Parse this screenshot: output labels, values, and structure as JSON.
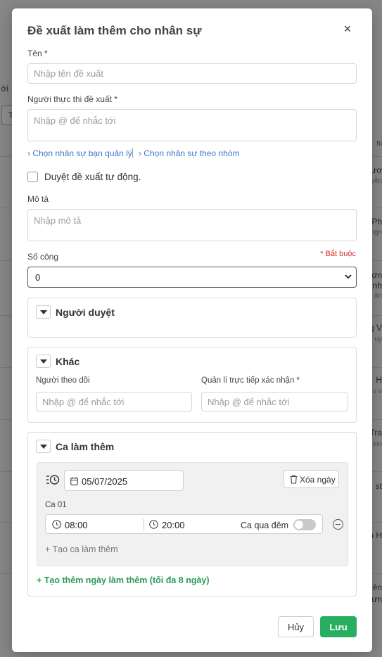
{
  "background": {
    "snippets": [
      "ời",
      "hi",
      "ươ",
      "uyên",
      "Ph",
      "ngn",
      "ươn",
      "nh",
      "ản",
      "g V",
      "uy",
      "H",
      "u v",
      "Tra",
      "ion",
      "st",
      "n H",
      "ên",
      "ưn"
    ],
    "button_label": "T"
  },
  "modal": {
    "title": "Đề xuất làm thêm cho nhân sự",
    "close_icon": "×"
  },
  "form": {
    "name": {
      "label": "Tên *",
      "placeholder": "Nhập tên đề xuất",
      "value": ""
    },
    "executor": {
      "label": "Người thực thi đề xuất *",
      "placeholder": "Nhập @ để nhắc tới",
      "value": ""
    },
    "links": {
      "managed": "› Chọn nhân sự bạn quản lý",
      "group": "› Chọn nhân sự theo nhóm"
    },
    "auto_approve": {
      "label": "Duyệt đề xuất tự động.",
      "checked": false
    },
    "description": {
      "label": "Mô tả",
      "placeholder": "Nhập mô tả",
      "value": ""
    },
    "work_units": {
      "label": "Số công",
      "required_note": "* Bắt buộc",
      "value": "0"
    }
  },
  "sections": {
    "approvers": {
      "title": "Người duyệt"
    },
    "other": {
      "title": "Khác",
      "follower_label": "Người theo dõi",
      "follower_placeholder": "Nhập @ để nhắc tới",
      "manager_label": "Quản lí trực tiếp xác nhận *",
      "manager_placeholder": "Nhập @ để nhắc tới"
    },
    "overtime": {
      "title": "Ca làm thêm",
      "date": "05/07/2025",
      "delete_day": "Xóa ngày",
      "shift_label": "Ca 01",
      "start_time": "08:00",
      "end_time": "20:00",
      "overnight_label": "Ca qua đêm",
      "overnight": false,
      "add_shift": "+ Tạo ca làm thêm",
      "add_day": "+ Tạo thêm ngày làm thêm (tối đa 8 ngày)"
    }
  },
  "footer": {
    "cancel": "Hủy",
    "save": "Lưu"
  },
  "colors": {
    "primary": "#27ae60",
    "link": "#3a78c2",
    "required": "#d23030"
  }
}
